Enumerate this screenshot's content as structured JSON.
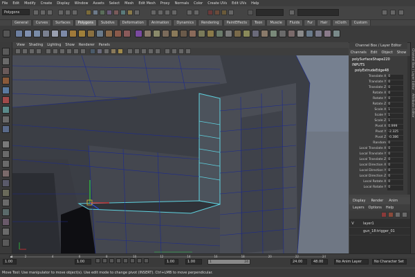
{
  "menubar": [
    "File",
    "Edit",
    "Modify",
    "Create",
    "Display",
    "Window",
    "Assets",
    "Select",
    "Mesh",
    "Edit Mesh",
    "Proxy",
    "Normals",
    "Color",
    "Create UVs",
    "Edit UVs",
    "Help"
  ],
  "statusline": {
    "mode": "Polygons"
  },
  "shelf_tabs": [
    "General",
    "Curves",
    "Surfaces",
    "Polygons",
    "Subdivs",
    "Deformation",
    "Animation",
    "Dynamics",
    "Rendering",
    "PaintEffects",
    "Toon",
    "Muscle",
    "Fluids",
    "Fur",
    "Hair",
    "nCloth",
    "Custom"
  ],
  "shelf_active": "Polygons",
  "panel_menu": [
    "View",
    "Shading",
    "Lighting",
    "Show",
    "Renderer",
    "Panels"
  ],
  "channel_box": {
    "title": "Channel Box / Layer Editor",
    "tabs": [
      "Channels",
      "Edit",
      "Object",
      "Show"
    ],
    "shape": "polySurfaceShape220",
    "inputs_label": "INPUTS",
    "node": "polyExtrudeEdge48",
    "attributes": [
      {
        "name": "Translate X",
        "value": "0"
      },
      {
        "name": "Translate Y",
        "value": "0"
      },
      {
        "name": "Translate Z",
        "value": "0"
      },
      {
        "name": "Rotate X",
        "value": "0"
      },
      {
        "name": "Rotate Y",
        "value": "0"
      },
      {
        "name": "Rotate Z",
        "value": "0"
      },
      {
        "name": "Scale X",
        "value": "1"
      },
      {
        "name": "Scale Y",
        "value": "1"
      },
      {
        "name": "Scale Z",
        "value": "1"
      },
      {
        "name": "Pivot X",
        "value": "0.999"
      },
      {
        "name": "Pivot Y",
        "value": "-2.325"
      },
      {
        "name": "Pivot Z",
        "value": "-0.386"
      },
      {
        "name": "Random",
        "value": "0"
      },
      {
        "name": "Local Translate X",
        "value": "0"
      },
      {
        "name": "Local Translate Y",
        "value": "0"
      },
      {
        "name": "Local Translate Z",
        "value": "0"
      },
      {
        "name": "Local Direction X",
        "value": "0"
      },
      {
        "name": "Local Direction Y",
        "value": "0"
      },
      {
        "name": "Local Direction Z",
        "value": "0"
      },
      {
        "name": "Local Rotate X",
        "value": "0"
      },
      {
        "name": "Local Rotate Y",
        "value": "0"
      }
    ]
  },
  "side_labels": [
    "Channel Box / Layer Editor",
    "Attribute Editor"
  ],
  "layer_editor": {
    "tabs": [
      "Display",
      "Render",
      "Anim"
    ],
    "menu": [
      "Layers",
      "Options",
      "Help"
    ],
    "layers": [
      {
        "visible": "V",
        "name": "layer1"
      },
      {
        "visible": "",
        "name": "gun_18:trigger_01"
      }
    ]
  },
  "time_slider": {
    "ticks": [
      "1",
      "2",
      "4",
      "6",
      "8",
      "10",
      "12",
      "14",
      "16",
      "18",
      "20",
      "22",
      "24"
    ],
    "start_field": "1.00",
    "start_field2": "1.00",
    "current": "1.00",
    "range_start": "1.00",
    "range_slider_label": "1",
    "range_end_slider": "24",
    "end_field": "24.00",
    "end_field2": "48.00",
    "anim_layer": "No Anim Layer",
    "char_set": "No Character Set"
  },
  "help_line": "Move Tool: Use manipulator to move object(s). Use edit mode to change pivot (INSERT). Ctrl+LMB to move perpendicular.",
  "colors": {
    "wire": "#1c2a8f",
    "highlight": "#5fd3e0",
    "shade": "#3a3d44"
  }
}
